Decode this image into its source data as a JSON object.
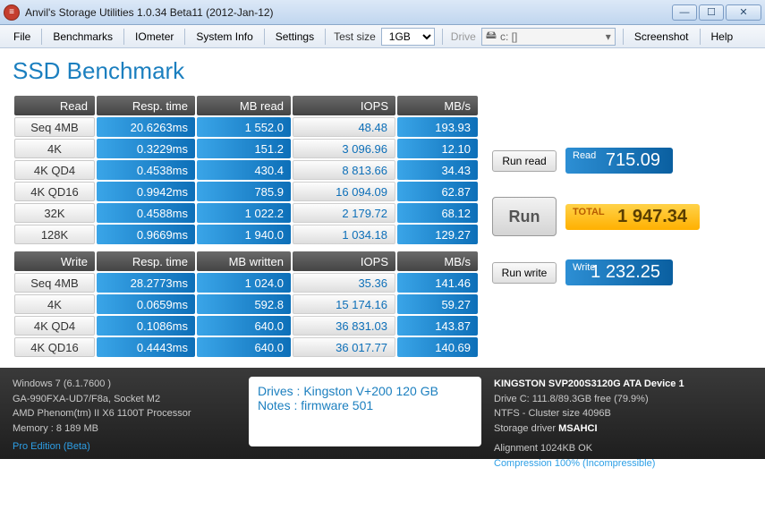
{
  "window": {
    "title": "Anvil's Storage Utilities 1.0.34 Beta11 (2012-Jan-12)"
  },
  "menu": {
    "file": "File",
    "benchmarks": "Benchmarks",
    "iometer": "IOmeter",
    "system_info": "System Info",
    "settings": "Settings",
    "test_size_label": "Test size",
    "test_size_value": "1GB",
    "drive_label": "Drive",
    "drive_value": "c: []",
    "screenshot": "Screenshot",
    "help": "Help"
  },
  "page_title": "SSD Benchmark",
  "headers": {
    "read": "Read",
    "write": "Write",
    "resp": "Resp. time",
    "mb_read": "MB read",
    "mb_written": "MB written",
    "iops": "IOPS",
    "mbs": "MB/s"
  },
  "read_rows": [
    {
      "label": "Seq 4MB",
      "resp": "20.6263ms",
      "mb": "1 552.0",
      "iops": "48.48",
      "mbs": "193.93"
    },
    {
      "label": "4K",
      "resp": "0.3229ms",
      "mb": "151.2",
      "iops": "3 096.96",
      "mbs": "12.10"
    },
    {
      "label": "4K QD4",
      "resp": "0.4538ms",
      "mb": "430.4",
      "iops": "8 813.66",
      "mbs": "34.43"
    },
    {
      "label": "4K QD16",
      "resp": "0.9942ms",
      "mb": "785.9",
      "iops": "16 094.09",
      "mbs": "62.87"
    },
    {
      "label": "32K",
      "resp": "0.4588ms",
      "mb": "1 022.2",
      "iops": "2 179.72",
      "mbs": "68.12"
    },
    {
      "label": "128K",
      "resp": "0.9669ms",
      "mb": "1 940.0",
      "iops": "1 034.18",
      "mbs": "129.27"
    }
  ],
  "write_rows": [
    {
      "label": "Seq 4MB",
      "resp": "28.2773ms",
      "mb": "1 024.0",
      "iops": "35.36",
      "mbs": "141.46"
    },
    {
      "label": "4K",
      "resp": "0.0659ms",
      "mb": "592.8",
      "iops": "15 174.16",
      "mbs": "59.27"
    },
    {
      "label": "4K QD4",
      "resp": "0.1086ms",
      "mb": "640.0",
      "iops": "36 831.03",
      "mbs": "143.87"
    },
    {
      "label": "4K QD16",
      "resp": "0.4443ms",
      "mb": "640.0",
      "iops": "36 017.77",
      "mbs": "140.69"
    }
  ],
  "buttons": {
    "run_read": "Run read",
    "run": "Run",
    "run_write": "Run write"
  },
  "scores": {
    "read_label": "Read",
    "read_value": "715.09",
    "write_label": "Write",
    "write_value": "1 232.25",
    "total_label": "TOTAL",
    "total_value": "1 947.34"
  },
  "footer": {
    "os": "Windows 7 (6.1.7600 )",
    "mobo": "GA-990FXA-UD7/F8a, Socket M2",
    "cpu": "AMD Phenom(tm) II X6 1100T Processor",
    "mem": "Memory : 8 189 MB",
    "edition": "Pro Edition (Beta)",
    "drives": "Drives : Kingston V+200 120 GB",
    "notes": "Notes : firmware 501",
    "device": "KINGSTON SVP200S3120G ATA Device 1",
    "cap": "Drive C: 111.8/89.3GB free (79.9%)",
    "fs": "NTFS - Cluster size 4096B",
    "driver_label": "Storage driver ",
    "driver": "MSAHCI",
    "align": "Alignment 1024KB OK",
    "compress": "Compression 100% (Incompressible)"
  },
  "chart_data": {
    "type": "table",
    "title": "SSD Benchmark",
    "drive": "Kingston V+200 120 GB",
    "read": {
      "rows": [
        "Seq 4MB",
        "4K",
        "4K QD4",
        "4K QD16",
        "32K",
        "128K"
      ],
      "resp_ms": [
        20.6263,
        0.3229,
        0.4538,
        0.9942,
        0.4588,
        0.9669
      ],
      "mb_read": [
        1552.0,
        151.2,
        430.4,
        785.9,
        1022.2,
        1940.0
      ],
      "iops": [
        48.48,
        3096.96,
        8813.66,
        16094.09,
        2179.72,
        1034.18
      ],
      "mbs": [
        193.93,
        12.1,
        34.43,
        62.87,
        68.12,
        129.27
      ],
      "score": 715.09
    },
    "write": {
      "rows": [
        "Seq 4MB",
        "4K",
        "4K QD4",
        "4K QD16"
      ],
      "resp_ms": [
        28.2773,
        0.0659,
        0.1086,
        0.4443
      ],
      "mb_written": [
        1024.0,
        592.8,
        640.0,
        640.0
      ],
      "iops": [
        35.36,
        15174.16,
        36831.03,
        36017.77
      ],
      "mbs": [
        141.46,
        59.27,
        143.87,
        140.69
      ],
      "score": 1232.25
    },
    "total": 1947.34
  }
}
